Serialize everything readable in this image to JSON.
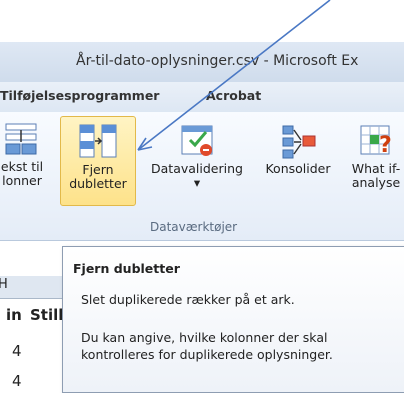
{
  "window": {
    "title": "År-til-dato-oplysninger.csv - Microsoft Ex"
  },
  "menu": [
    "Tilføjelsesprogrammer",
    "Acrobat"
  ],
  "ribbon": {
    "buttons": [
      {
        "line1": "ekst til",
        "line2": "lonner",
        "icon": "text-to-columns-icon"
      },
      {
        "line1": "Fjern",
        "line2": "dubletter",
        "icon": "remove-duplicates-icon"
      },
      {
        "line1": "Datavalidering",
        "line2": "▾",
        "icon": "data-validation-icon"
      },
      {
        "line1": "Konsolider",
        "line2": "",
        "icon": "consolidate-icon"
      },
      {
        "line1": "What if-",
        "line2": "analyse",
        "icon": "what-if-analysis-icon"
      }
    ],
    "group_label": "Dataværktøjer"
  },
  "sheet": {
    "col_header_partial": "H",
    "row1": [
      "in",
      "Still"
    ],
    "values": [
      "4",
      "4"
    ]
  },
  "tooltip": {
    "title": "Fjern dubletter",
    "line1": "Slet duplikerede rækker på et ark.",
    "line2": "Du kan angive, hvilke kolonner der skal kontrolleres for duplikerede oplysninger."
  },
  "colors": {
    "accent": "#fde28a",
    "arrow": "#4a78c4"
  }
}
